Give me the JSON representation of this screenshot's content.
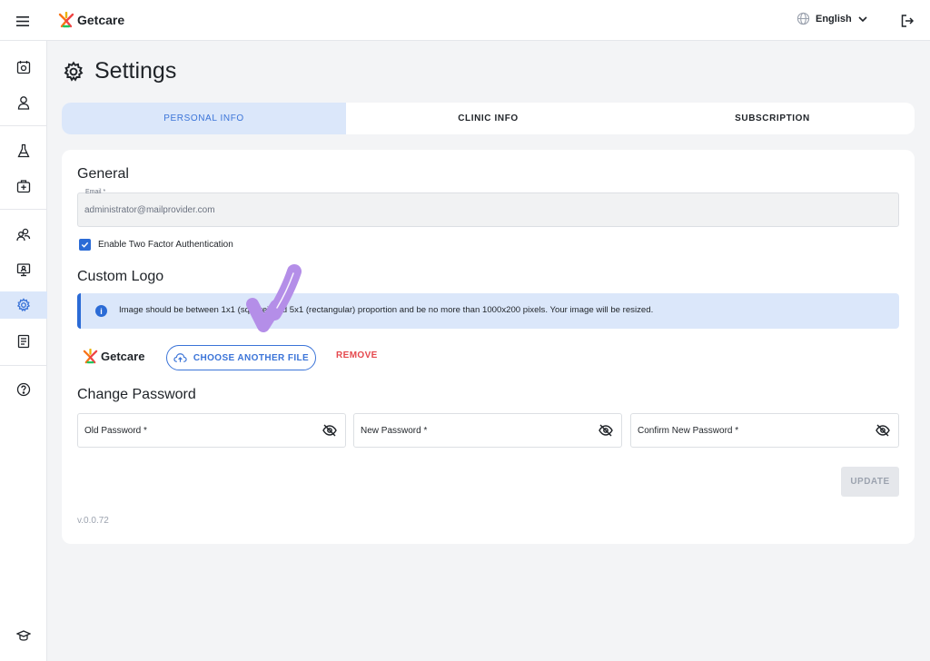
{
  "header": {
    "brand": "Getcare",
    "language": "English"
  },
  "sidebar": {
    "items": [
      {
        "icon": "calendar-icon"
      },
      {
        "icon": "person-icon"
      },
      {
        "icon": "flask-icon"
      },
      {
        "icon": "medical-kit-icon"
      },
      {
        "icon": "users-icon"
      },
      {
        "icon": "monitor-icon"
      },
      {
        "icon": "gear-icon",
        "active": true
      },
      {
        "icon": "document-icon"
      },
      {
        "icon": "help-icon"
      },
      {
        "icon": "graduation-cap-icon"
      }
    ]
  },
  "page": {
    "title": "Settings",
    "tabs": [
      {
        "label": "PERSONAL INFO",
        "active": true
      },
      {
        "label": "CLINIC INFO"
      },
      {
        "label": "SUBSCRIPTION"
      }
    ]
  },
  "general": {
    "title": "General",
    "email_label": "Email *",
    "email_value": "administrator@mailprovider.com",
    "two_factor_label": "Enable Two Factor Authentication",
    "two_factor_checked": true
  },
  "custom_logo": {
    "title": "Custom Logo",
    "info": "Image should be between 1x1 (square) and 5x1 (rectangular) proportion and be no more than 1000x200 pixels. Your image will be resized.",
    "preview_brand": "Getcare",
    "choose_label": "CHOOSE ANOTHER FILE",
    "remove_label": "REMOVE"
  },
  "change_password": {
    "title": "Change Password",
    "old_label": "Old Password *",
    "new_label": "New Password *",
    "confirm_label": "Confirm New Password *",
    "update_label": "UPDATE"
  },
  "version": "v.0.0.72",
  "colors": {
    "accent": "#3b74d8",
    "tab_active_bg": "#dbe7fa",
    "remove": "#e5484d",
    "annotation": "#b48ee8"
  }
}
